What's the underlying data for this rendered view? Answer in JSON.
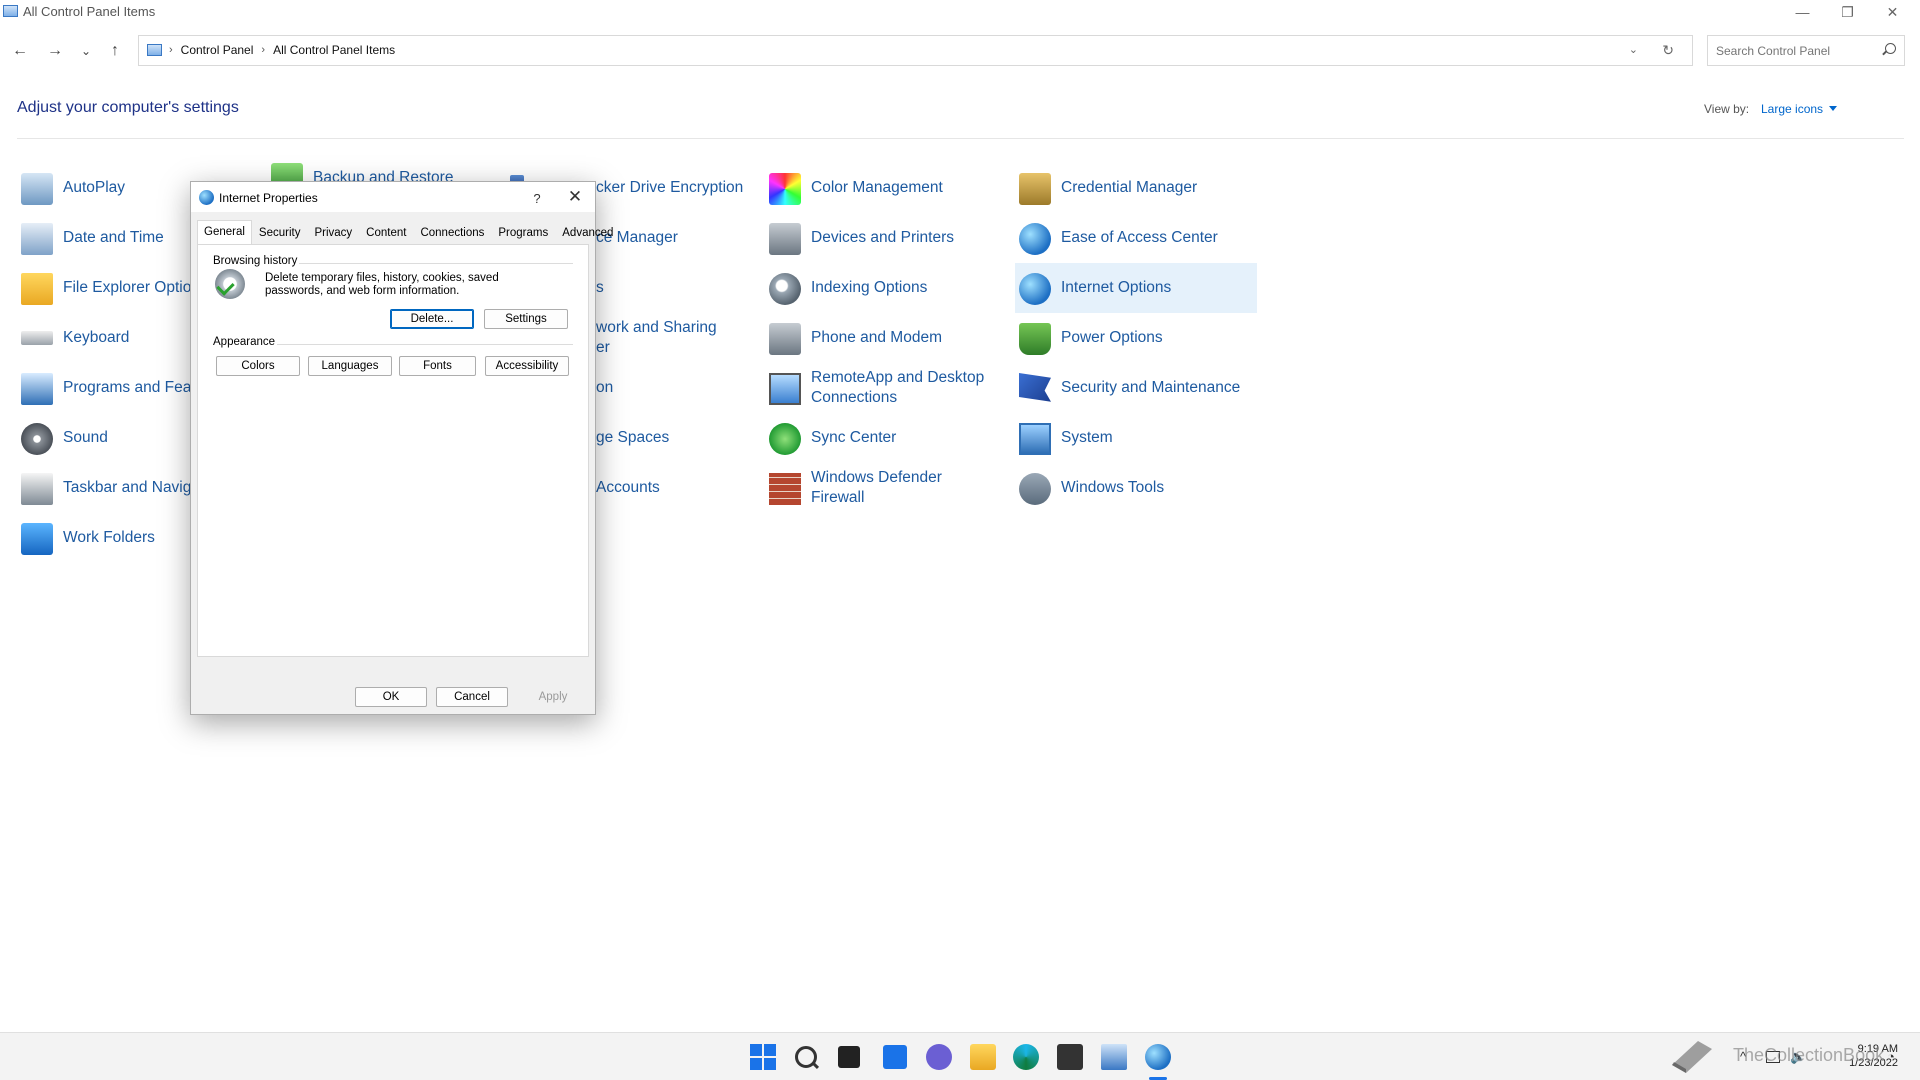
{
  "window": {
    "title": "All Control Panel Items",
    "min": "—",
    "max": "❐",
    "close": "✕"
  },
  "nav": {
    "back": "←",
    "forward": "→",
    "recent": "⌄",
    "up": "↑"
  },
  "address": {
    "crumbs": [
      "Control Panel",
      "All Control Panel Items"
    ],
    "sep": "›",
    "dropdown": "⌄",
    "refresh": "↻"
  },
  "search": {
    "placeholder": "Search Control Panel"
  },
  "header": {
    "title": "Adjust your computer's settings",
    "viewby_label": "View by:",
    "viewby_value": "Large icons"
  },
  "items": [
    {
      "label": "AutoPlay",
      "icon": "autoplay-icon"
    },
    {
      "label": "Date and Time",
      "icon": "date-time-icon"
    },
    {
      "label": "File Explorer Options",
      "icon": "folder-icon"
    },
    {
      "label": "Keyboard",
      "icon": "keyboard-icon"
    },
    {
      "label": "Programs and Features",
      "icon": "programs-icon"
    },
    {
      "label": "Sound",
      "icon": "speaker-icon"
    },
    {
      "label": "Taskbar and Navigation",
      "icon": "taskbar-icon"
    },
    {
      "label": "Work Folders",
      "icon": "work-folders-icon"
    },
    {
      "label": "Backup and Restore",
      "icon": "backup-icon"
    },
    {
      "label": "BitLocker Drive Encryption",
      "icon": "bitlocker-icon"
    },
    {
      "label": "Device Manager",
      "icon": "device-manager-icon"
    },
    {
      "label": "Fonts",
      "icon": "fonts-icon"
    },
    {
      "label": "Network and Sharing Center",
      "icon": "network-icon"
    },
    {
      "label": "Recovery",
      "icon": "recovery-icon"
    },
    {
      "label": "Storage Spaces",
      "icon": "storage-icon"
    },
    {
      "label": "User Accounts",
      "icon": "user-accounts-icon"
    },
    {
      "label": "Color Management",
      "icon": "color-management-icon"
    },
    {
      "label": "Devices and Printers",
      "icon": "printer-icon"
    },
    {
      "label": "Indexing Options",
      "icon": "indexing-icon"
    },
    {
      "label": "Phone and Modem",
      "icon": "phone-icon"
    },
    {
      "label": "RemoteApp and Desktop Connections",
      "icon": "remote-desktop-icon"
    },
    {
      "label": "Sync Center",
      "icon": "sync-icon"
    },
    {
      "label": "Windows Defender Firewall",
      "icon": "firewall-icon"
    },
    {
      "label": "Credential Manager",
      "icon": "credential-icon"
    },
    {
      "label": "Ease of Access Center",
      "icon": "ease-of-access-icon"
    },
    {
      "label": "Internet Options",
      "icon": "internet-options-icon"
    },
    {
      "label": "Power Options",
      "icon": "power-icon"
    },
    {
      "label": "Security and Maintenance",
      "icon": "flag-icon"
    },
    {
      "label": "System",
      "icon": "system-icon"
    },
    {
      "label": "Windows Tools",
      "icon": "tools-icon"
    }
  ],
  "visible_fragments": {
    "file_explorer": "File Explorer Optio",
    "programs": "Programs and Feat",
    "taskbar": "Taskbar and Navig",
    "backup": "Backup and Restore",
    "bitlocker": "cker Drive Encryption",
    "device_manager": "ce Manager",
    "fonts": "s",
    "network_1": "work and Sharing",
    "network_2": "er",
    "recovery": "on",
    "storage": "ge Spaces",
    "accounts": "Accounts"
  },
  "dialog": {
    "title": "Internet Properties",
    "help": "?",
    "close": "✕",
    "tabs": [
      "General",
      "Security",
      "Privacy",
      "Content",
      "Connections",
      "Programs",
      "Advanced"
    ],
    "browsing_history": {
      "heading": "Browsing history",
      "text": "Delete temporary files, history, cookies, saved passwords, and web form information.",
      "delete": "Delete...",
      "settings": "Settings"
    },
    "appearance": {
      "heading": "Appearance",
      "buttons": [
        "Colors",
        "Languages",
        "Fonts",
        "Accessibility"
      ]
    },
    "ok": "OK",
    "cancel": "Cancel",
    "apply": "Apply"
  },
  "taskbar": {
    "clock_time": "9:19 AM",
    "clock_date": "1/23/2022",
    "tray_caret": "^",
    "watermark": "TheCollectionBook"
  }
}
